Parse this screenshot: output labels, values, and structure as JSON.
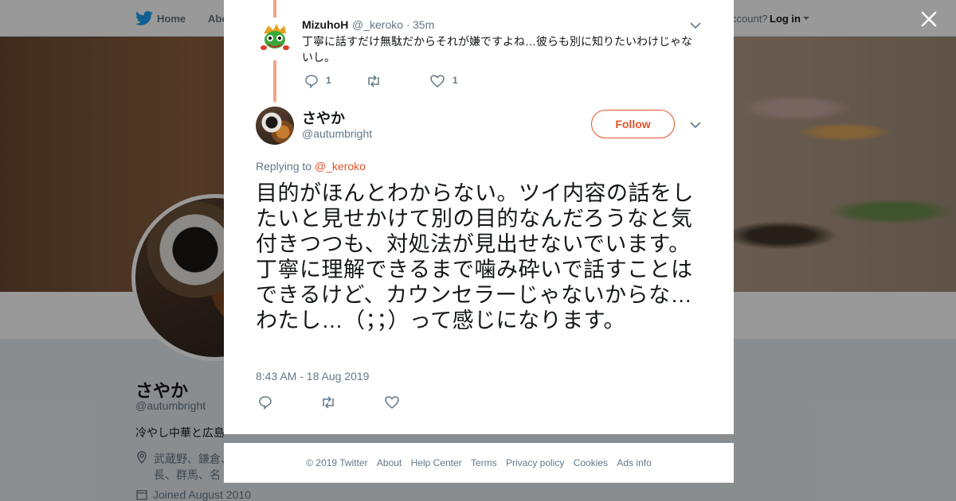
{
  "nav": {
    "home": "Home",
    "about": "Abo",
    "account_prompt": "ccount?",
    "login": "Log in"
  },
  "profile": {
    "name": "さやか",
    "handle": "@autumbright",
    "bio": "冷やし中華と広島",
    "location": "武蔵野、鎌倉、 長、群馬、名",
    "joined": "Joined August 2010"
  },
  "reply_tweet": {
    "name": "MizuhoH",
    "handle": "@_keroko",
    "separator": "·",
    "time": "35m",
    "text": "丁寧に話すだけ無駄だからそれが嫌ですよね…彼らも別に知りたいわけじゃないし。",
    "reply_count": "1",
    "like_count": "1"
  },
  "main_tweet": {
    "name": "さやか",
    "handle": "@autumbright",
    "follow_label": "Follow",
    "replying_prefix": "Replying to",
    "replying_to": "@_keroko",
    "text": "目的がほんとわからない。ツイ内容の話をしたいと見せかけて別の目的なんだろうなと気付きつつも、対処法が見出せないでいます。丁寧に理解できるまで噛み砕いで話すことはできるけど、カウンセラーじゃないからな…わたし…（；；）って感じになります。",
    "timestamp": "8:43 AM - 18 Aug 2019"
  },
  "footer": {
    "copyright": "© 2019 Twitter",
    "about": "About",
    "help": "Help Center",
    "terms": "Terms",
    "privacy": "Privacy policy",
    "cookies": "Cookies",
    "ads": "Ads info"
  },
  "colors": {
    "accent": "#e0522a",
    "thread_line": "#f5a38a",
    "twitter_blue": "#1da1f2",
    "secondary_text": "#657786"
  },
  "icons": [
    "twitter-logo-icon",
    "close-icon",
    "chevron-down-icon",
    "reply-icon",
    "retweet-icon",
    "like-icon",
    "location-icon",
    "calendar-icon"
  ]
}
